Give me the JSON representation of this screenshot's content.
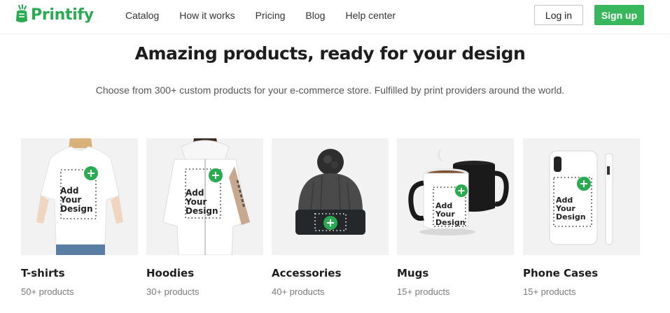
{
  "brand": {
    "name": "Printify",
    "color": "#29ab51"
  },
  "nav": {
    "items": [
      {
        "label": "Catalog"
      },
      {
        "label": "How it works"
      },
      {
        "label": "Pricing"
      },
      {
        "label": "Blog"
      },
      {
        "label": "Help center"
      }
    ]
  },
  "auth": {
    "login_label": "Log in",
    "signup_label": "Sign up",
    "signup_color": "#39b75d"
  },
  "hero": {
    "title": "Amazing products, ready for your design",
    "subtitle": "Choose from 300+ custom products for your e-commerce store. Fulfilled by print providers around the world."
  },
  "products": [
    {
      "name": "T-shirts",
      "count": "50+ products",
      "design_text": [
        "Add",
        "Your",
        "Design"
      ]
    },
    {
      "name": "Hoodies",
      "count": "30+ products",
      "design_text": [
        "Add",
        "Your",
        "Design"
      ]
    },
    {
      "name": "Accessories",
      "count": "40+ products"
    },
    {
      "name": "Mugs",
      "count": "15+ products",
      "design_text": [
        "Add",
        "Your",
        "Design"
      ]
    },
    {
      "name": "Phone Cases",
      "count": "15+ products",
      "design_text": [
        "Add",
        "Your",
        "Design"
      ]
    }
  ]
}
